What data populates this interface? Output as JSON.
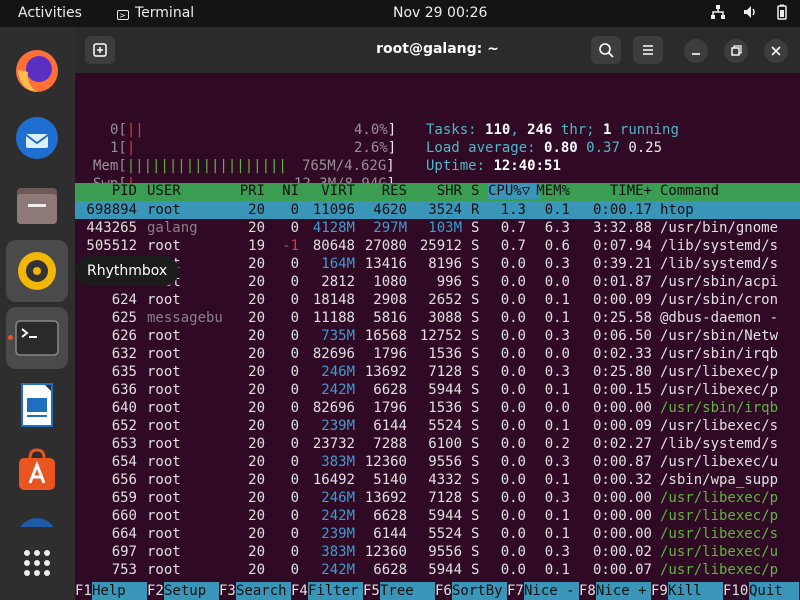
{
  "topbar": {
    "activities": "Activities",
    "app_name": "Terminal",
    "clock": "Nov 29  00:26"
  },
  "dock": {
    "tooltip": "Rhythmbox"
  },
  "window": {
    "title": "root@galang: ~"
  },
  "meters": {
    "cpu0_label": "0[",
    "cpu0_bar": "||",
    "cpu0_value": "4.0%",
    "cpu1_label": "1[",
    "cpu1_bar": "|",
    "cpu1_value": "2.6%",
    "mem_label": "Mem[",
    "mem_bar": "|||||||||||||||||||",
    "mem_value": "765M/4.62G",
    "swp_label": "Swp[",
    "swp_bar": "|",
    "swp_value": "12.3M/8.94G",
    "close": "]"
  },
  "summary": {
    "tasks_label": "Tasks: ",
    "tasks": "110",
    "thr": "246",
    "thr_label": " thr; ",
    "running": "1",
    "running_label": " running",
    "load_label": "Load average: ",
    "load1": "0.80",
    "load5": "0.37",
    "load15": "0.25",
    "uptime_label": "Uptime: ",
    "uptime": "12:40:51"
  },
  "columns": [
    "PID",
    "USER",
    "PRI",
    "NI",
    "VIRT",
    "RES",
    "SHR",
    "S",
    "CPU%",
    "MEM%",
    "TIME+",
    "Command"
  ],
  "sort_marker": "▽",
  "processes": [
    {
      "pid": "698894",
      "user": "root",
      "pri": "20",
      "ni": "0",
      "virt": "11096",
      "res": "4620",
      "shr": "3524",
      "s": "R",
      "cpu": "1.3",
      "mem": "0.1",
      "time": "0:00.17",
      "cmd": "htop"
    },
    {
      "pid": "443265",
      "user": "galang",
      "pri": "20",
      "ni": "0",
      "virt": "4128M",
      "res": "297M",
      "shr": "103M",
      "s": "S",
      "cpu": "0.7",
      "mem": "6.3",
      "time": "3:32.88",
      "cmd": "/usr/bin/gnome"
    },
    {
      "pid": "505512",
      "user": "root",
      "pri": "19",
      "ni": "-1",
      "virt": "80648",
      "res": "27080",
      "shr": "25912",
      "s": "S",
      "cpu": "0.7",
      "mem": "0.6",
      "time": "0:07.94",
      "cmd": "/lib/systemd/s"
    },
    {
      "pid": "",
      "user": "root",
      "pri": "20",
      "ni": "0",
      "virt": "164M",
      "res": "13416",
      "shr": "8196",
      "s": "S",
      "cpu": "0.0",
      "mem": "0.3",
      "time": "0:39.21",
      "cmd": "/lib/systemd/s"
    },
    {
      "pid": "",
      "user": "root",
      "pri": "20",
      "ni": "0",
      "virt": "2812",
      "res": "1080",
      "shr": "996",
      "s": "S",
      "cpu": "0.0",
      "mem": "0.0",
      "time": "0:01.87",
      "cmd": "/usr/sbin/acpi"
    },
    {
      "pid": "624",
      "user": "root",
      "pri": "20",
      "ni": "0",
      "virt": "18148",
      "res": "2908",
      "shr": "2652",
      "s": "S",
      "cpu": "0.0",
      "mem": "0.1",
      "time": "0:00.09",
      "cmd": "/usr/sbin/cron"
    },
    {
      "pid": "625",
      "user": "messagebu",
      "pri": "20",
      "ni": "0",
      "virt": "11188",
      "res": "5816",
      "shr": "3088",
      "s": "S",
      "cpu": "0.0",
      "mem": "0.1",
      "time": "0:25.58",
      "cmd": "@dbus-daemon -"
    },
    {
      "pid": "626",
      "user": "root",
      "pri": "20",
      "ni": "0",
      "virt": "735M",
      "res": "16568",
      "shr": "12752",
      "s": "S",
      "cpu": "0.0",
      "mem": "0.3",
      "time": "0:06.50",
      "cmd": "/usr/sbin/Netw"
    },
    {
      "pid": "632",
      "user": "root",
      "pri": "20",
      "ni": "0",
      "virt": "82696",
      "res": "1796",
      "shr": "1536",
      "s": "S",
      "cpu": "0.0",
      "mem": "0.0",
      "time": "0:02.33",
      "cmd": "/usr/sbin/irqb"
    },
    {
      "pid": "635",
      "user": "root",
      "pri": "20",
      "ni": "0",
      "virt": "246M",
      "res": "13692",
      "shr": "7128",
      "s": "S",
      "cpu": "0.0",
      "mem": "0.3",
      "time": "0:25.80",
      "cmd": "/usr/libexec/p"
    },
    {
      "pid": "636",
      "user": "root",
      "pri": "20",
      "ni": "0",
      "virt": "242M",
      "res": "6628",
      "shr": "5944",
      "s": "S",
      "cpu": "0.0",
      "mem": "0.1",
      "time": "0:00.15",
      "cmd": "/usr/libexec/p"
    },
    {
      "pid": "640",
      "user": "root",
      "pri": "20",
      "ni": "0",
      "virt": "82696",
      "res": "1796",
      "shr": "1536",
      "s": "S",
      "cpu": "0.0",
      "mem": "0.0",
      "time": "0:00.00",
      "cmd": "/usr/sbin/irqb"
    },
    {
      "pid": "652",
      "user": "root",
      "pri": "20",
      "ni": "0",
      "virt": "239M",
      "res": "6144",
      "shr": "5524",
      "s": "S",
      "cpu": "0.0",
      "mem": "0.1",
      "time": "0:00.09",
      "cmd": "/usr/libexec/s"
    },
    {
      "pid": "653",
      "user": "root",
      "pri": "20",
      "ni": "0",
      "virt": "23732",
      "res": "7288",
      "shr": "6100",
      "s": "S",
      "cpu": "0.0",
      "mem": "0.2",
      "time": "0:02.27",
      "cmd": "/lib/systemd/s"
    },
    {
      "pid": "654",
      "user": "root",
      "pri": "20",
      "ni": "0",
      "virt": "383M",
      "res": "12360",
      "shr": "9556",
      "s": "S",
      "cpu": "0.0",
      "mem": "0.3",
      "time": "0:00.87",
      "cmd": "/usr/libexec/u"
    },
    {
      "pid": "656",
      "user": "root",
      "pri": "20",
      "ni": "0",
      "virt": "16492",
      "res": "5140",
      "shr": "4332",
      "s": "S",
      "cpu": "0.0",
      "mem": "0.1",
      "time": "0:00.32",
      "cmd": "/sbin/wpa_supp"
    },
    {
      "pid": "659",
      "user": "root",
      "pri": "20",
      "ni": "0",
      "virt": "246M",
      "res": "13692",
      "shr": "7128",
      "s": "S",
      "cpu": "0.0",
      "mem": "0.3",
      "time": "0:00.00",
      "cmd": "/usr/libexec/p"
    },
    {
      "pid": "660",
      "user": "root",
      "pri": "20",
      "ni": "0",
      "virt": "242M",
      "res": "6628",
      "shr": "5944",
      "s": "S",
      "cpu": "0.0",
      "mem": "0.1",
      "time": "0:00.00",
      "cmd": "/usr/libexec/p"
    },
    {
      "pid": "664",
      "user": "root",
      "pri": "20",
      "ni": "0",
      "virt": "239M",
      "res": "6144",
      "shr": "5524",
      "s": "S",
      "cpu": "0.0",
      "mem": "0.1",
      "time": "0:00.00",
      "cmd": "/usr/libexec/s"
    },
    {
      "pid": "697",
      "user": "root",
      "pri": "20",
      "ni": "0",
      "virt": "383M",
      "res": "12360",
      "shr": "9556",
      "s": "S",
      "cpu": "0.0",
      "mem": "0.3",
      "time": "0:00.02",
      "cmd": "/usr/libexec/u"
    },
    {
      "pid": "753",
      "user": "root",
      "pri": "20",
      "ni": "0",
      "virt": "242M",
      "res": "6628",
      "shr": "5944",
      "s": "S",
      "cpu": "0.0",
      "mem": "0.1",
      "time": "0:00.07",
      "cmd": "/usr/libexec/p"
    }
  ],
  "footer": [
    {
      "key": "F1",
      "label": "Help"
    },
    {
      "key": "F2",
      "label": "Setup"
    },
    {
      "key": "F3",
      "label": "Search"
    },
    {
      "key": "F4",
      "label": "Filter"
    },
    {
      "key": "F5",
      "label": "Tree"
    },
    {
      "key": "F6",
      "label": "SortBy"
    },
    {
      "key": "F7",
      "label": "Nice -"
    },
    {
      "key": "F8",
      "label": "Nice +"
    },
    {
      "key": "F9",
      "label": "Kill"
    },
    {
      "key": "F10",
      "label": "Quit"
    }
  ],
  "colors": {
    "terminal_bg": "#300a24",
    "header_row": "#3a9d52",
    "selected_row": "#3a96b8",
    "accent": "#e95420"
  }
}
